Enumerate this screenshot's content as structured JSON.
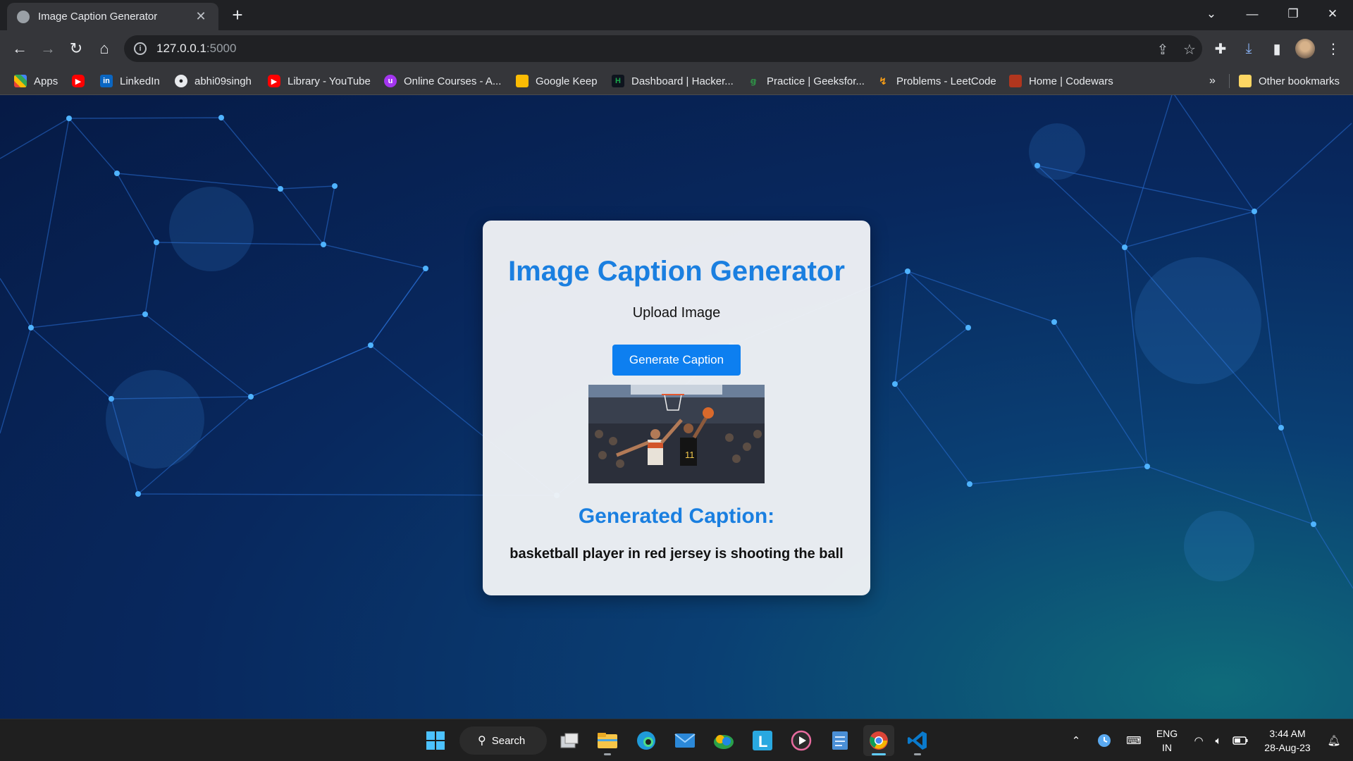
{
  "browser": {
    "tab_title": "Image Caption Generator",
    "new_tab_label": "+",
    "address_host": "127.0.0.1",
    "address_port": ":5000",
    "bookmarks": [
      {
        "label": "Apps",
        "icon": "apps-grid-icon",
        "color": "#ea4335"
      },
      {
        "label": "",
        "icon": "youtube-icon",
        "color": "#ff0000"
      },
      {
        "label": "LinkedIn",
        "icon": "linkedin-icon",
        "color": "#0a66c2"
      },
      {
        "label": "abhi09singh",
        "icon": "github-icon",
        "color": "#e8eaed"
      },
      {
        "label": "Library - YouTube",
        "icon": "youtube-icon",
        "color": "#ff0000"
      },
      {
        "label": "Online Courses - A...",
        "icon": "udemy-icon",
        "color": "#a435f0"
      },
      {
        "label": "Google Keep",
        "icon": "keep-icon",
        "color": "#fbbc04"
      },
      {
        "label": "Dashboard | Hacker...",
        "icon": "hackerrank-icon",
        "color": "#1ba94c"
      },
      {
        "label": "Practice | Geeksfor...",
        "icon": "gfg-icon",
        "color": "#2f8d46"
      },
      {
        "label": "Problems - LeetCode",
        "icon": "leetcode-icon",
        "color": "#ffa116"
      },
      {
        "label": "Home | Codewars",
        "icon": "codewars-icon",
        "color": "#b1361e"
      }
    ],
    "more_bookmarks": "»",
    "other_bookmarks": "Other bookmarks"
  },
  "page": {
    "title": "Image Caption Generator",
    "upload_label": "Upload Image",
    "generate_button": "Generate Caption",
    "caption_heading": "Generated Caption:",
    "caption_text": "basketball player in red jersey is shooting the ball",
    "accent_color": "#1a7fe0",
    "button_color": "#0d7ff0"
  },
  "taskbar": {
    "search_label": "Search",
    "lang_line1": "ENG",
    "lang_line2": "IN",
    "time": "3:44 AM",
    "date": "28-Aug-23"
  }
}
